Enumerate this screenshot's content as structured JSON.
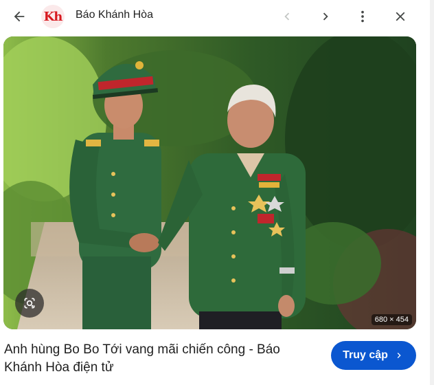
{
  "header": {
    "logo_text": "Kh",
    "source_name": "Báo Khánh Hòa",
    "back_icon": "arrow-left-icon",
    "prev_icon": "chevron-left-icon",
    "next_icon": "chevron-right-icon",
    "more_icon": "more-vert-icon",
    "close_icon": "close-icon"
  },
  "image": {
    "dimensions_label": "680 × 454",
    "lens_icon": "google-lens-icon"
  },
  "caption": {
    "title": "Anh hùng Bo Bo Tới vang mãi chiến công - Báo Khánh Hòa điện tử"
  },
  "action": {
    "visit_label": "Truy cập",
    "visit_icon": "chevron-right-icon"
  },
  "colors": {
    "accent": "#0b57d0",
    "logo_red": "#d71920",
    "uniform_green": "#2f6b3f"
  }
}
